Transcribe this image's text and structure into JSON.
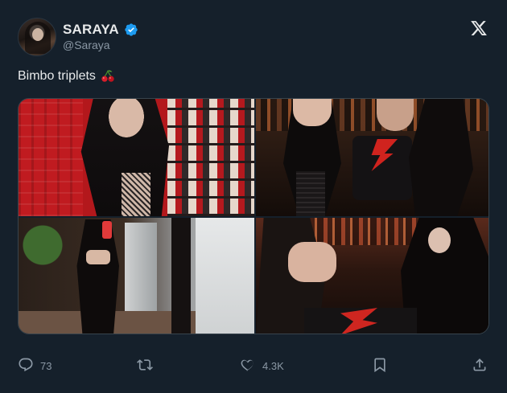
{
  "author": {
    "display_name": "SARAYA",
    "handle": "@Saraya",
    "verified": true
  },
  "tweet": {
    "text": "Bimbo triplets",
    "emoji": "cherry-emoji"
  },
  "media": {
    "photo_count": 4
  },
  "actions": {
    "replies": "73",
    "likes": "4.3K"
  },
  "colors": {
    "background": "#15202b",
    "text": "#e7e9ea",
    "muted": "#8b98a5",
    "verified": "#1d9bf0",
    "border": "#38444d"
  },
  "icons": {
    "platform": "x-logo-icon",
    "reply": "reply-icon",
    "retweet": "retweet-icon",
    "like": "heart-icon",
    "bookmark": "bookmark-icon",
    "share": "share-icon",
    "verified": "verified-badge-icon"
  }
}
